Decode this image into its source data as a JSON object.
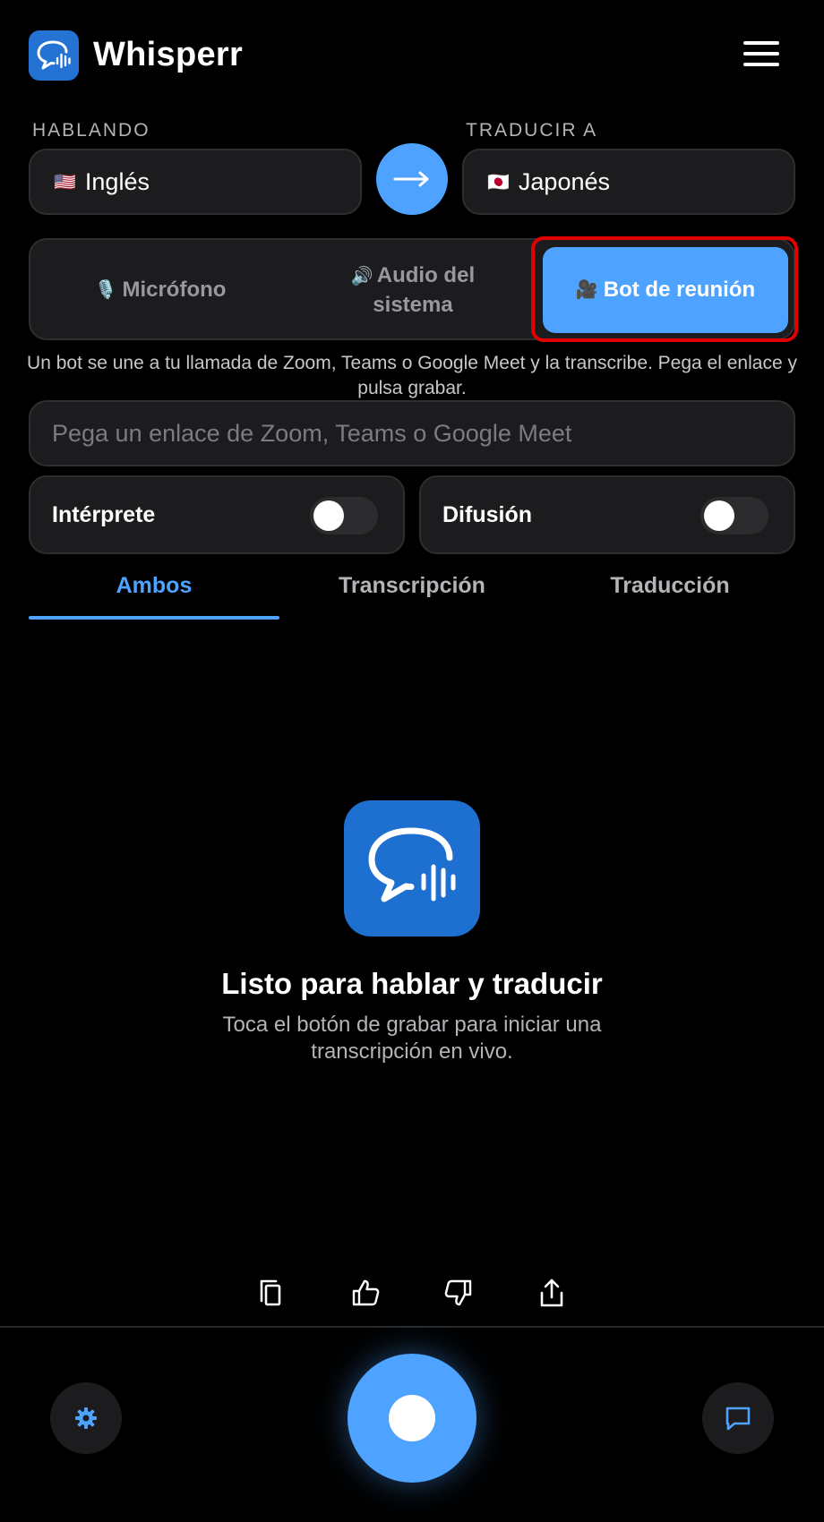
{
  "app": {
    "name": "Whisperr",
    "logo_icon": "chat-waveform-icon",
    "menu_icon": "hamburger-menu-icon"
  },
  "languages": {
    "source_label": "HABLANDO",
    "source_flag": "🇺🇸",
    "source_value": "Inglés",
    "target_label": "TRADUCIR A",
    "target_flag": "🇯🇵",
    "target_value": "Japonés",
    "swap_icon": "arrow-right-icon"
  },
  "source_modes": {
    "items": [
      {
        "icon": "🎙️",
        "label": "Micrófono",
        "active": false
      },
      {
        "icon": "🔊",
        "label": "Audio del sistema",
        "active": false
      },
      {
        "icon": "🎥",
        "label": "Bot de reunión",
        "active": true
      }
    ],
    "helper_text": "Un bot se une a tu llamada de Zoom, Teams o Google Meet y la transcribe. Pega el enlace y pulsa grabar."
  },
  "meeting_link": {
    "value": "",
    "placeholder": "Pega un enlace de Zoom, Teams o Google Meet"
  },
  "toggles": {
    "interpreter": {
      "label": "Intérprete",
      "on": false
    },
    "broadcast": {
      "label": "Difusión",
      "on": false
    }
  },
  "tabs": [
    {
      "label": "Ambos",
      "active": true
    },
    {
      "label": "Transcripción",
      "active": false
    },
    {
      "label": "Traducción",
      "active": false
    }
  ],
  "empty_state": {
    "icon": "chat-waveform-icon",
    "title": "Listo para hablar y traducir",
    "subtitle": "Toca el botón de grabar para iniciar una transcripción en vivo."
  },
  "actions": [
    "copy-icon",
    "thumbs-up-icon",
    "thumbs-down-icon",
    "share-icon"
  ],
  "bottom_bar": {
    "settings_icon": "gear-icon",
    "record_icon": "record-icon",
    "chat_icon": "chat-icon"
  },
  "colors": {
    "accent": "#4da3ff",
    "logo_blue": "#2372d4",
    "card": "#1c1c1e",
    "highlight": "#e30000",
    "background": "#000000"
  }
}
